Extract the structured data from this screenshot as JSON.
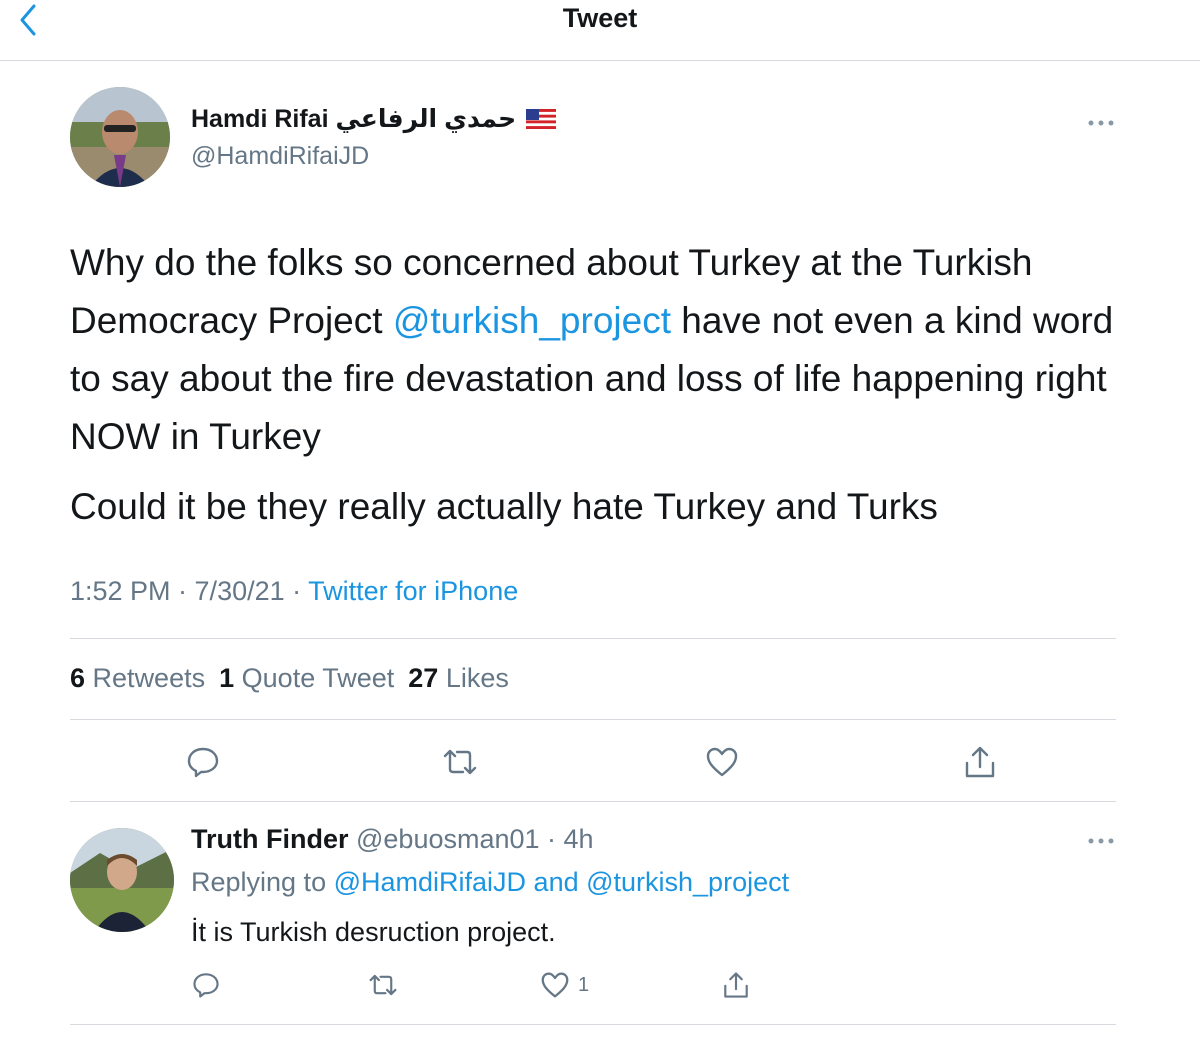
{
  "header": {
    "title": "Tweet"
  },
  "tweet": {
    "author_name": "Hamdi Rifai حمدي الرفاعي",
    "author_handle": "@HamdiRifaiJD",
    "paragraphs": [
      {
        "before": "Why do the folks so concerned about Turkey at the Turkish Democracy Project ",
        "mention": "@turkish_project",
        "after": " have not even a kind word to say about the fire devastation and loss of life happening right NOW in Turkey"
      },
      {
        "text": "Could it be they really actually hate Turkey and Turks"
      }
    ],
    "time": "1:52 PM · 7/30/21 · ",
    "source": "Twitter for iPhone",
    "stats": {
      "retweets_num": "6",
      "retweets_label": "Retweets",
      "quotes_num": "1",
      "quotes_label": "Quote Tweet",
      "likes_num": "27",
      "likes_label": "Likes"
    }
  },
  "reply": {
    "name": "Truth Finder",
    "handle_time": " @ebuosman01 · 4h",
    "replying_prefix": "Replying to ",
    "mention1": "@HamdiRifaiJD",
    "and": " and ",
    "mention2": "@turkish_project",
    "text": "İt is Turkish desruction project.",
    "like_count": "1"
  },
  "icons": {
    "back": "chevron-left-icon",
    "more": "ellipsis-icon",
    "reply": "comment-icon",
    "retweet": "retweet-icon",
    "like": "heart-icon",
    "share": "share-icon",
    "flag": "us-flag-icon"
  },
  "colors": {
    "accent": "#1b95e0",
    "muted": "#657786",
    "text": "#14171a",
    "divider": "#d6dadf"
  }
}
